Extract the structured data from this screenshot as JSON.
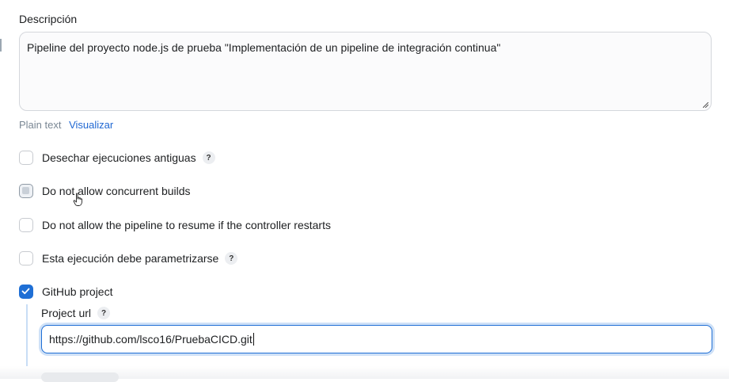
{
  "description": {
    "label": "Descripción",
    "value": "Pipeline del proyecto node.js de prueba \"Implementación de un pipeline de integración continua\""
  },
  "format_links": {
    "plain_text": "Plain text",
    "preview": "Visualizar"
  },
  "options": [
    {
      "label": "Desechar ejecuciones antiguas",
      "checked": false,
      "help": "?"
    },
    {
      "label": "Do not allow concurrent builds",
      "checked": false
    },
    {
      "label": "Do not allow the pipeline to resume if the controller restarts",
      "checked": false
    },
    {
      "label": "Esta ejecución debe parametrizarse",
      "checked": false,
      "help": "?"
    },
    {
      "label": "GitHub project",
      "checked": true
    }
  ],
  "github": {
    "project_url_label": "Project url",
    "help": "?",
    "project_url_value": "https://github.com/lsco16/PruebaCICD.git"
  },
  "colors": {
    "accent": "#1f6fd5",
    "link": "#1f67d2"
  }
}
